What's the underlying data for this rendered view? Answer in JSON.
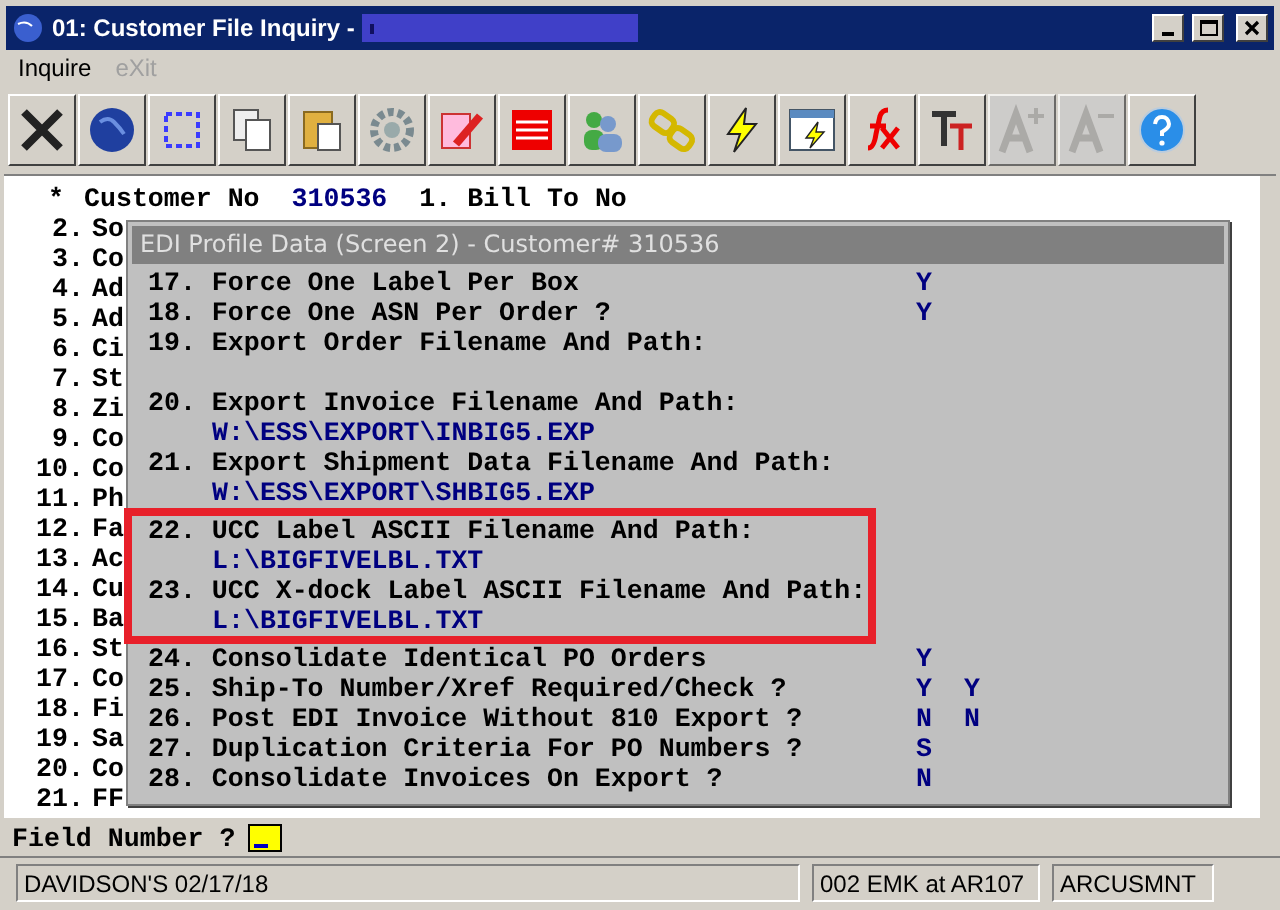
{
  "window": {
    "title": "01: Customer File Inquiry -"
  },
  "menu": [
    {
      "label": "Inquire",
      "disabled": false
    },
    {
      "label": "eXit",
      "disabled": true
    }
  ],
  "toolbar": [
    {
      "disabled": false
    },
    {
      "disabled": false
    },
    {
      "disabled": false
    },
    {
      "disabled": false
    },
    {
      "disabled": false
    },
    {
      "disabled": false
    },
    {
      "disabled": false
    },
    {
      "disabled": false
    },
    {
      "disabled": false
    },
    {
      "disabled": false
    },
    {
      "disabled": false
    },
    {
      "disabled": false
    },
    {
      "disabled": false
    },
    {
      "disabled": false
    },
    {
      "disabled": true
    },
    {
      "disabled": true
    },
    {
      "disabled": false
    }
  ],
  "screen": {
    "header": {
      "marker": "*",
      "label": "Customer No",
      "value": "310536",
      "field": "1. Bill To No"
    },
    "rows": [
      {
        "number": "2.",
        "label": "So"
      },
      {
        "number": "3.",
        "label": "Co"
      },
      {
        "number": "4.",
        "label": "Ad"
      },
      {
        "number": "5.",
        "label": "Ad"
      },
      {
        "number": "6.",
        "label": "Ci"
      },
      {
        "number": "7.",
        "label": "St"
      },
      {
        "number": "8.",
        "label": "Zi"
      },
      {
        "number": "9.",
        "label": "Co"
      },
      {
        "number": "10.",
        "label": "Co"
      },
      {
        "number": "11.",
        "label": "Ph"
      },
      {
        "number": "12.",
        "label": "Fa"
      },
      {
        "number": "13.",
        "label": "Ac"
      },
      {
        "number": "14.",
        "label": "Cu"
      },
      {
        "number": "15.",
        "label": "Ba"
      },
      {
        "number": "16.",
        "label": "St"
      },
      {
        "number": "17.",
        "label": "Co"
      },
      {
        "number": "18.",
        "label": "Fi"
      },
      {
        "number": "19.",
        "label": "Sa"
      },
      {
        "number": "20.",
        "label": "Co"
      },
      {
        "number": "21.",
        "label": "FF"
      }
    ],
    "prompt": "Field Number ?"
  },
  "dialog": {
    "title": "EDI Profile Data (Screen 2) - Customer# 310536",
    "items": [
      {
        "number": "17.",
        "label": "Force One Label Per Box",
        "values": [
          "Y"
        ],
        "highlighted": false
      },
      {
        "number": "18.",
        "label": "Force One ASN Per Order ?",
        "values": [
          "Y"
        ],
        "highlighted": false
      },
      {
        "number": "19.",
        "label": "Export Order Filename And Path:",
        "kind": "path",
        "highlighted": false
      },
      {
        "number": "20.",
        "label": "Export Invoice Filename And Path:",
        "path": "W:\\ESS\\EXPORT\\INBIG5.EXP",
        "highlighted": false
      },
      {
        "number": "21.",
        "label": "Export Shipment Data Filename And Path:",
        "path": "W:\\ESS\\EXPORT\\SHBIG5.EXP",
        "highlighted": false
      },
      {
        "number": "22.",
        "label": "UCC Label ASCII Filename And Path:",
        "path": "L:\\BIGFIVELBL.TXT",
        "highlighted": true
      },
      {
        "number": "23.",
        "label": "UCC X-dock Label ASCII Filename And Path:",
        "path": "L:\\BIGFIVELBL.TXT",
        "highlighted": true
      },
      {
        "number": "24.",
        "label": "Consolidate Identical PO Orders",
        "values": [
          "Y"
        ],
        "highlighted": false
      },
      {
        "number": "25.",
        "label": "Ship-To Number/Xref Required/Check ?",
        "values": [
          "Y",
          "Y"
        ],
        "highlighted": false
      },
      {
        "number": "26.",
        "label": "Post EDI Invoice Without 810 Export ?",
        "values": [
          "N",
          "N"
        ],
        "highlighted": false
      },
      {
        "number": "27.",
        "label": "Duplication Criteria For PO Numbers ?",
        "values": [
          "S"
        ],
        "highlighted": false
      },
      {
        "number": "28.",
        "label": "Consolidate Invoices On Export ?",
        "values": [
          "N"
        ],
        "highlighted": false
      }
    ]
  },
  "status_bar": [
    "DAVIDSON'S 02/17/18",
    "002 EMK at AR107",
    "ARCUSMNT"
  ]
}
